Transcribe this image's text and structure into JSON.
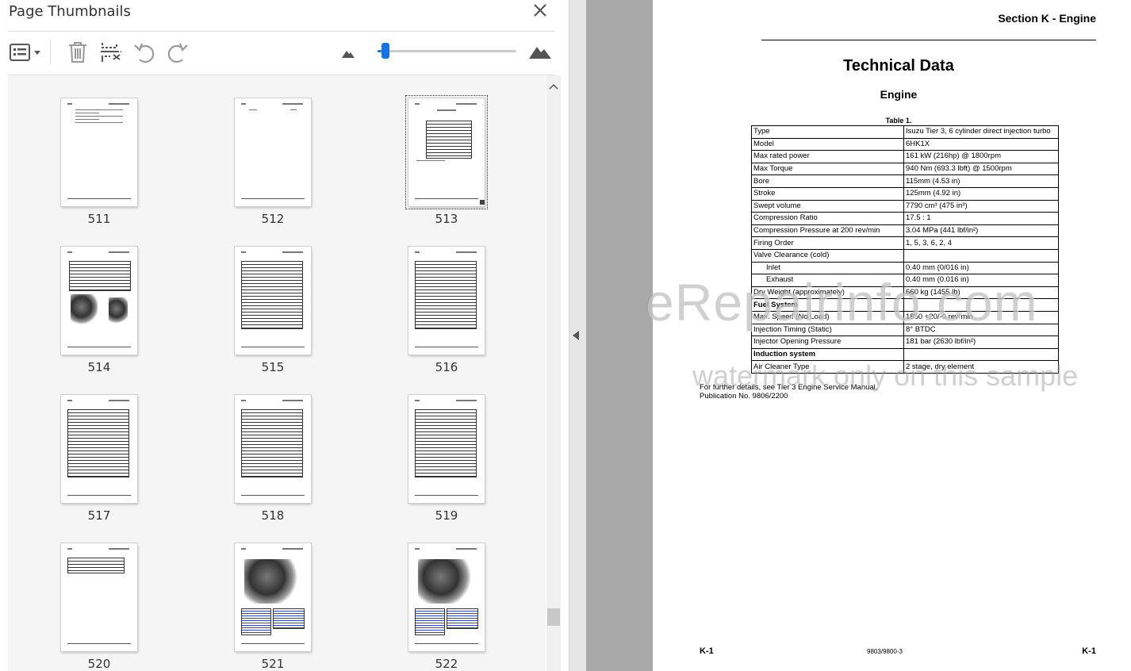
{
  "panel": {
    "title": "Page Thumbnails",
    "icons": {
      "options": "list-options-icon",
      "delete": "trash-icon",
      "extract": "extract-pages-icon",
      "rotate_ccw": "rotate-counterclockwise-icon",
      "rotate_cw": "rotate-clockwise-icon",
      "zoom_out": "small-mountain-icon",
      "zoom_in": "large-mountain-icon",
      "close": "close-icon"
    },
    "zoom_slider_level": 0.03
  },
  "thumbnails": [
    {
      "page": "511",
      "kind": "toc"
    },
    {
      "page": "512",
      "kind": "blank"
    },
    {
      "page": "513",
      "kind": "table",
      "selected": true
    },
    {
      "page": "514",
      "kind": "table-image"
    },
    {
      "page": "515",
      "kind": "grid"
    },
    {
      "page": "516",
      "kind": "grid"
    },
    {
      "page": "517",
      "kind": "grid"
    },
    {
      "page": "518",
      "kind": "grid"
    },
    {
      "page": "519",
      "kind": "grid"
    },
    {
      "page": "520",
      "kind": "grid-short"
    },
    {
      "page": "521",
      "kind": "engine"
    },
    {
      "page": "522",
      "kind": "engine"
    }
  ],
  "document": {
    "section_header": "Section K - Engine",
    "title": "Technical Data",
    "subtitle": "Engine",
    "table_caption": "Table 1.",
    "rows": [
      {
        "label": "Type",
        "value": "Isuzu Tier 3, 6 cylinder direct injection turbo"
      },
      {
        "label": "Model",
        "value": "6HK1X"
      },
      {
        "label": "Max rated power",
        "value": "161 kW (216hp) @ 1800rpm"
      },
      {
        "label": "Max Torque",
        "value": "940 Nm (693.3 lbft) @ 1500rpm"
      },
      {
        "label": "Bore",
        "value": "115mm (4.53 in)"
      },
      {
        "label": "Stroke",
        "value": "125mm (4.92 in)"
      },
      {
        "label": "Swept volume",
        "value": "7790 cm³ (475 in³)"
      },
      {
        "label": "Compression Ratio",
        "value": "17.5 : 1"
      },
      {
        "label": "Compression Pressure at 200 rev/min",
        "value": "3.04 MPa (441 lbf/in²)"
      },
      {
        "label": "Firing Order",
        "value": "1, 5, 3, 6, 2, 4"
      },
      {
        "label": "Valve Clearance (cold)",
        "value": "",
        "span": true
      },
      {
        "label": "Inlet",
        "value": "0.40 mm (0/016 in)",
        "indent": true
      },
      {
        "label": "Exhaust",
        "value": "0.40 mm (0.016 in)",
        "indent": true
      },
      {
        "label": "Dry Weight (approximately)",
        "value": "660 kg (1455 lb)"
      },
      {
        "label": "Fuel System",
        "value": "",
        "span": true,
        "bold": true
      },
      {
        "label": "Max. Speed (No Load)",
        "value": "1850 +20/-0 rev/min"
      },
      {
        "label": "Injection Timing (Static)",
        "value": "8° BTDC"
      },
      {
        "label": "Injector Opening Pressure",
        "value": "181 bar (2630 lbf/in²)"
      },
      {
        "label": "Induction system",
        "value": "",
        "span": true,
        "bold": true
      },
      {
        "label": "Air Cleaner Type",
        "value": "2 stage, dry element"
      }
    ],
    "note_line1": "For further details, see Tier 3 Engine Service Manual,",
    "note_line2": "Publication No. 9806/2200",
    "watermark_main": "eRepairinfo.com",
    "watermark_sub": "watermark only on this sample",
    "footer_left": "K-1",
    "footer_center": "9803/9800-3",
    "footer_right": "K-1"
  }
}
